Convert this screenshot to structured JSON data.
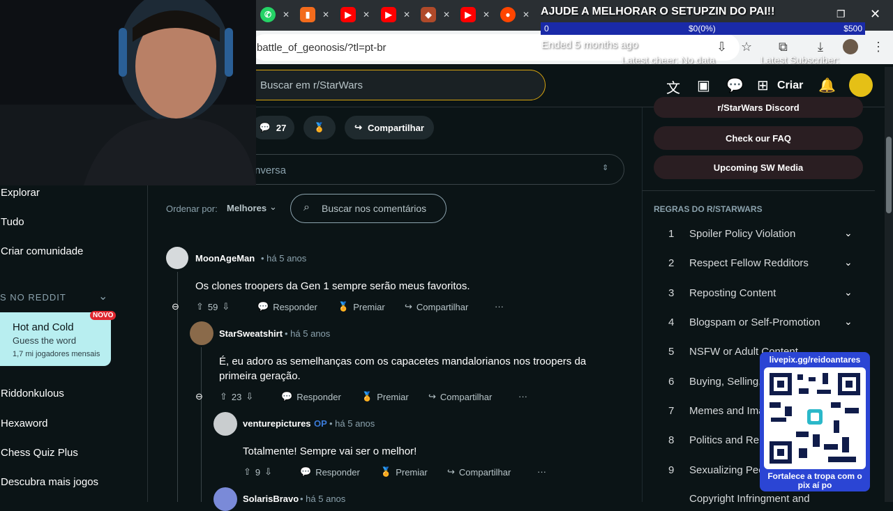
{
  "browser": {
    "url": "battle_of_geonosis/?tl=pt-br",
    "tabs": [
      {
        "icon": "whatsapp-icon",
        "color": "#25d366"
      },
      {
        "icon": "bookmark-icon",
        "color": "#f36b1c"
      },
      {
        "icon": "youtube-icon",
        "color": "#ff0000"
      },
      {
        "icon": "youtube-icon",
        "color": "#ff0000"
      },
      {
        "icon": "tab-icon",
        "color": "#e34c26"
      },
      {
        "icon": "youtube-icon",
        "color": "#ff0000"
      },
      {
        "icon": "reddit-icon",
        "color": "#ff4500"
      }
    ]
  },
  "stream_overlay": {
    "banner": "AJUDE A MELHORAR O SETUPZIN DO PAI!!",
    "goal_min": "0",
    "goal_current": "$0(0%)",
    "goal_max": "$500",
    "ended": "Ended 5 months ago",
    "latest_cheer": "Latest cheer: No data",
    "latest_subscriber": "Latest Subscriber:",
    "qr_title": "livepix.gg/reidoantares",
    "qr_caption": "Fortalece a tropa com o pix aí po"
  },
  "header": {
    "search_placeholder": "Buscar em r/StarWars",
    "create_label": "Criar"
  },
  "post_actions": {
    "comments_count": "27",
    "share_label": "Compartilhar"
  },
  "conversation_placeholder": "nversa",
  "sort": {
    "label": "Ordenar por:",
    "value": "Melhores",
    "search_placeholder": "Buscar nos comentários"
  },
  "left_nav": {
    "items": [
      "Explorar",
      "Tudo",
      "Criar comunidade"
    ],
    "section": "S NO REDDIT",
    "game_card": {
      "title": "Hot and Cold",
      "subtitle": "Guess the word",
      "players": "1,7 mi jogadores mensais",
      "badge": "NOVO"
    },
    "games": [
      "Riddonkulous",
      "Hexaword",
      "Chess Quiz Plus",
      "Descubra mais jogos"
    ]
  },
  "comments": [
    {
      "author": "MoonAgeMan",
      "time": "há 5 anos",
      "body": "Os clones troopers da Gen 1 sempre serão meus favoritos.",
      "votes": "59"
    },
    {
      "author": "StarSweatshirt",
      "time": "há 5 anos",
      "body": "É, eu adoro as semelhanças com os capacetes mandalorianos nos troopers da primeira geração.",
      "votes": "23"
    },
    {
      "author": "venturepictures",
      "op": "OP",
      "time": "há 5 anos",
      "body": "Totalmente! Sempre vai ser o melhor!",
      "votes": "9"
    },
    {
      "author": "SolarisBravo",
      "time": "há 5 anos"
    }
  ],
  "comment_actions": {
    "reply": "Responder",
    "award": "Premiar",
    "share": "Compartilhar",
    "more": "···"
  },
  "right_sidebar": {
    "buttons": [
      "r/StarWars Discord",
      "Check our FAQ",
      "Upcoming SW Media"
    ],
    "rules_title": "REGRAS DO R/STARWARS",
    "rules": [
      {
        "n": "1",
        "t": "Spoiler Policy Violation"
      },
      {
        "n": "2",
        "t": "Respect Fellow Redditors"
      },
      {
        "n": "3",
        "t": "Reposting Content"
      },
      {
        "n": "4",
        "t": "Blogspam or Self-Promotion"
      },
      {
        "n": "5",
        "t": "NSFW or Adult Content"
      },
      {
        "n": "6",
        "t": "Buying, Selling,"
      },
      {
        "n": "7",
        "t": "Memes and Ima"
      },
      {
        "n": "8",
        "t": "Politics and Reli"
      },
      {
        "n": "9",
        "t": "Sexualizing Peo"
      },
      {
        "n": "",
        "t": "Copyright Infringment and"
      }
    ]
  }
}
